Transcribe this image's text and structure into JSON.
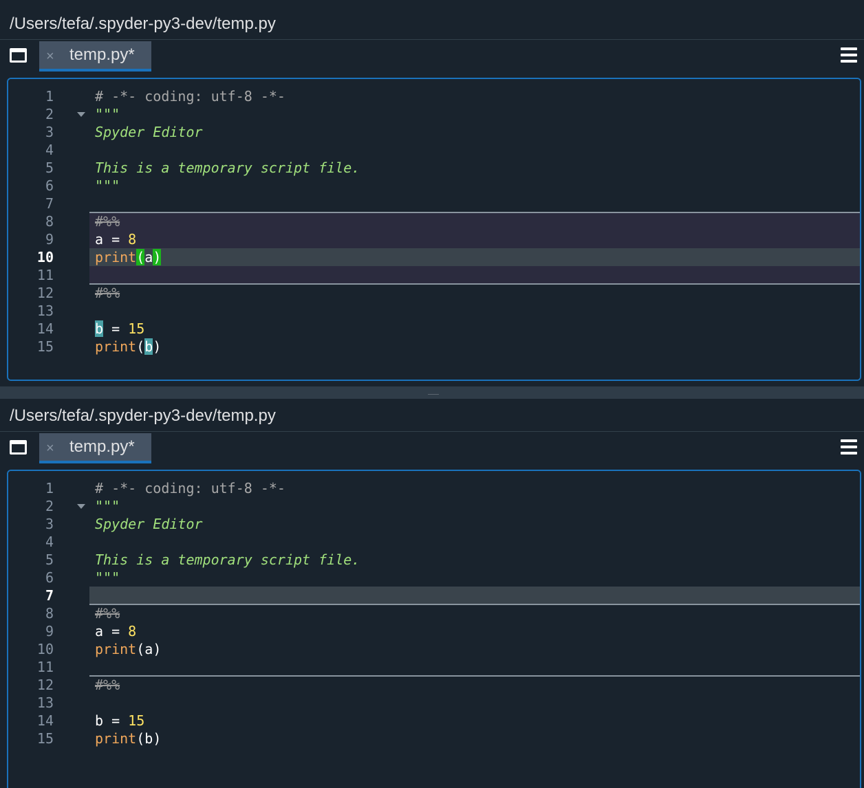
{
  "panes": [
    {
      "file_path": "/Users/tefa/.spyder-py3-dev/temp.py",
      "tab": {
        "close_glyph": "×",
        "label": "temp.py*"
      },
      "current_line": 10,
      "line_numbers": [
        "1",
        "2",
        "3",
        "4",
        "5",
        "6",
        "7",
        "8",
        "9",
        "10",
        "11",
        "12",
        "13",
        "14",
        "15"
      ],
      "code": {
        "l1": "# -*- coding: utf-8 -*-",
        "l2": "\"\"\"",
        "l3": "Spyder Editor",
        "l5": "This is a temporary script file.",
        "l6": "\"\"\"",
        "l8": "#%%",
        "l9_var": "a",
        "l9_op": " = ",
        "l9_num": "8",
        "l10_fn": "print",
        "l10_open": "(",
        "l10_arg": "a",
        "l10_close": ")",
        "l12": "#%%",
        "l14_var": "b",
        "l14_op": " = ",
        "l14_num": "15",
        "l15_fn": "print",
        "l15_open": "(",
        "l15_arg": "b",
        "l15_close": ")"
      }
    },
    {
      "file_path": "/Users/tefa/.spyder-py3-dev/temp.py",
      "tab": {
        "close_glyph": "×",
        "label": "temp.py*"
      },
      "current_line": 7,
      "line_numbers": [
        "1",
        "2",
        "3",
        "4",
        "5",
        "6",
        "7",
        "8",
        "9",
        "10",
        "11",
        "12",
        "13",
        "14",
        "15"
      ],
      "code": {
        "l1": "# -*- coding: utf-8 -*-",
        "l2": "\"\"\"",
        "l3": "Spyder Editor",
        "l5": "This is a temporary script file.",
        "l6": "\"\"\"",
        "l8": "#%%",
        "l9_var": "a",
        "l9_op": " = ",
        "l9_num": "8",
        "l10_fn": "print",
        "l10_open": "(",
        "l10_arg": "a",
        "l10_close": ")",
        "l12": "#%%",
        "l14_var": "b",
        "l14_op": " = ",
        "l14_num": "15",
        "l15_fn": "print",
        "l15_open": "(",
        "l15_arg": "b",
        "l15_close": ")"
      }
    }
  ],
  "icons": {
    "browse_tabs": "browse-tabs-icon",
    "options_menu": "hamburger-menu-icon",
    "fold": "fold-arrow-icon"
  },
  "colors": {
    "background": "#19232d",
    "accent": "#1a72bb",
    "tab_bg": "#455364",
    "docstring": "#a1e07c",
    "number": "#ffe363",
    "builtin": "#f2a85b",
    "matched_paren": "#1bb51b",
    "occurrence": "#4aa1a6",
    "cell_highlight": "#2b2b3e",
    "current_line": "#3a444c"
  }
}
